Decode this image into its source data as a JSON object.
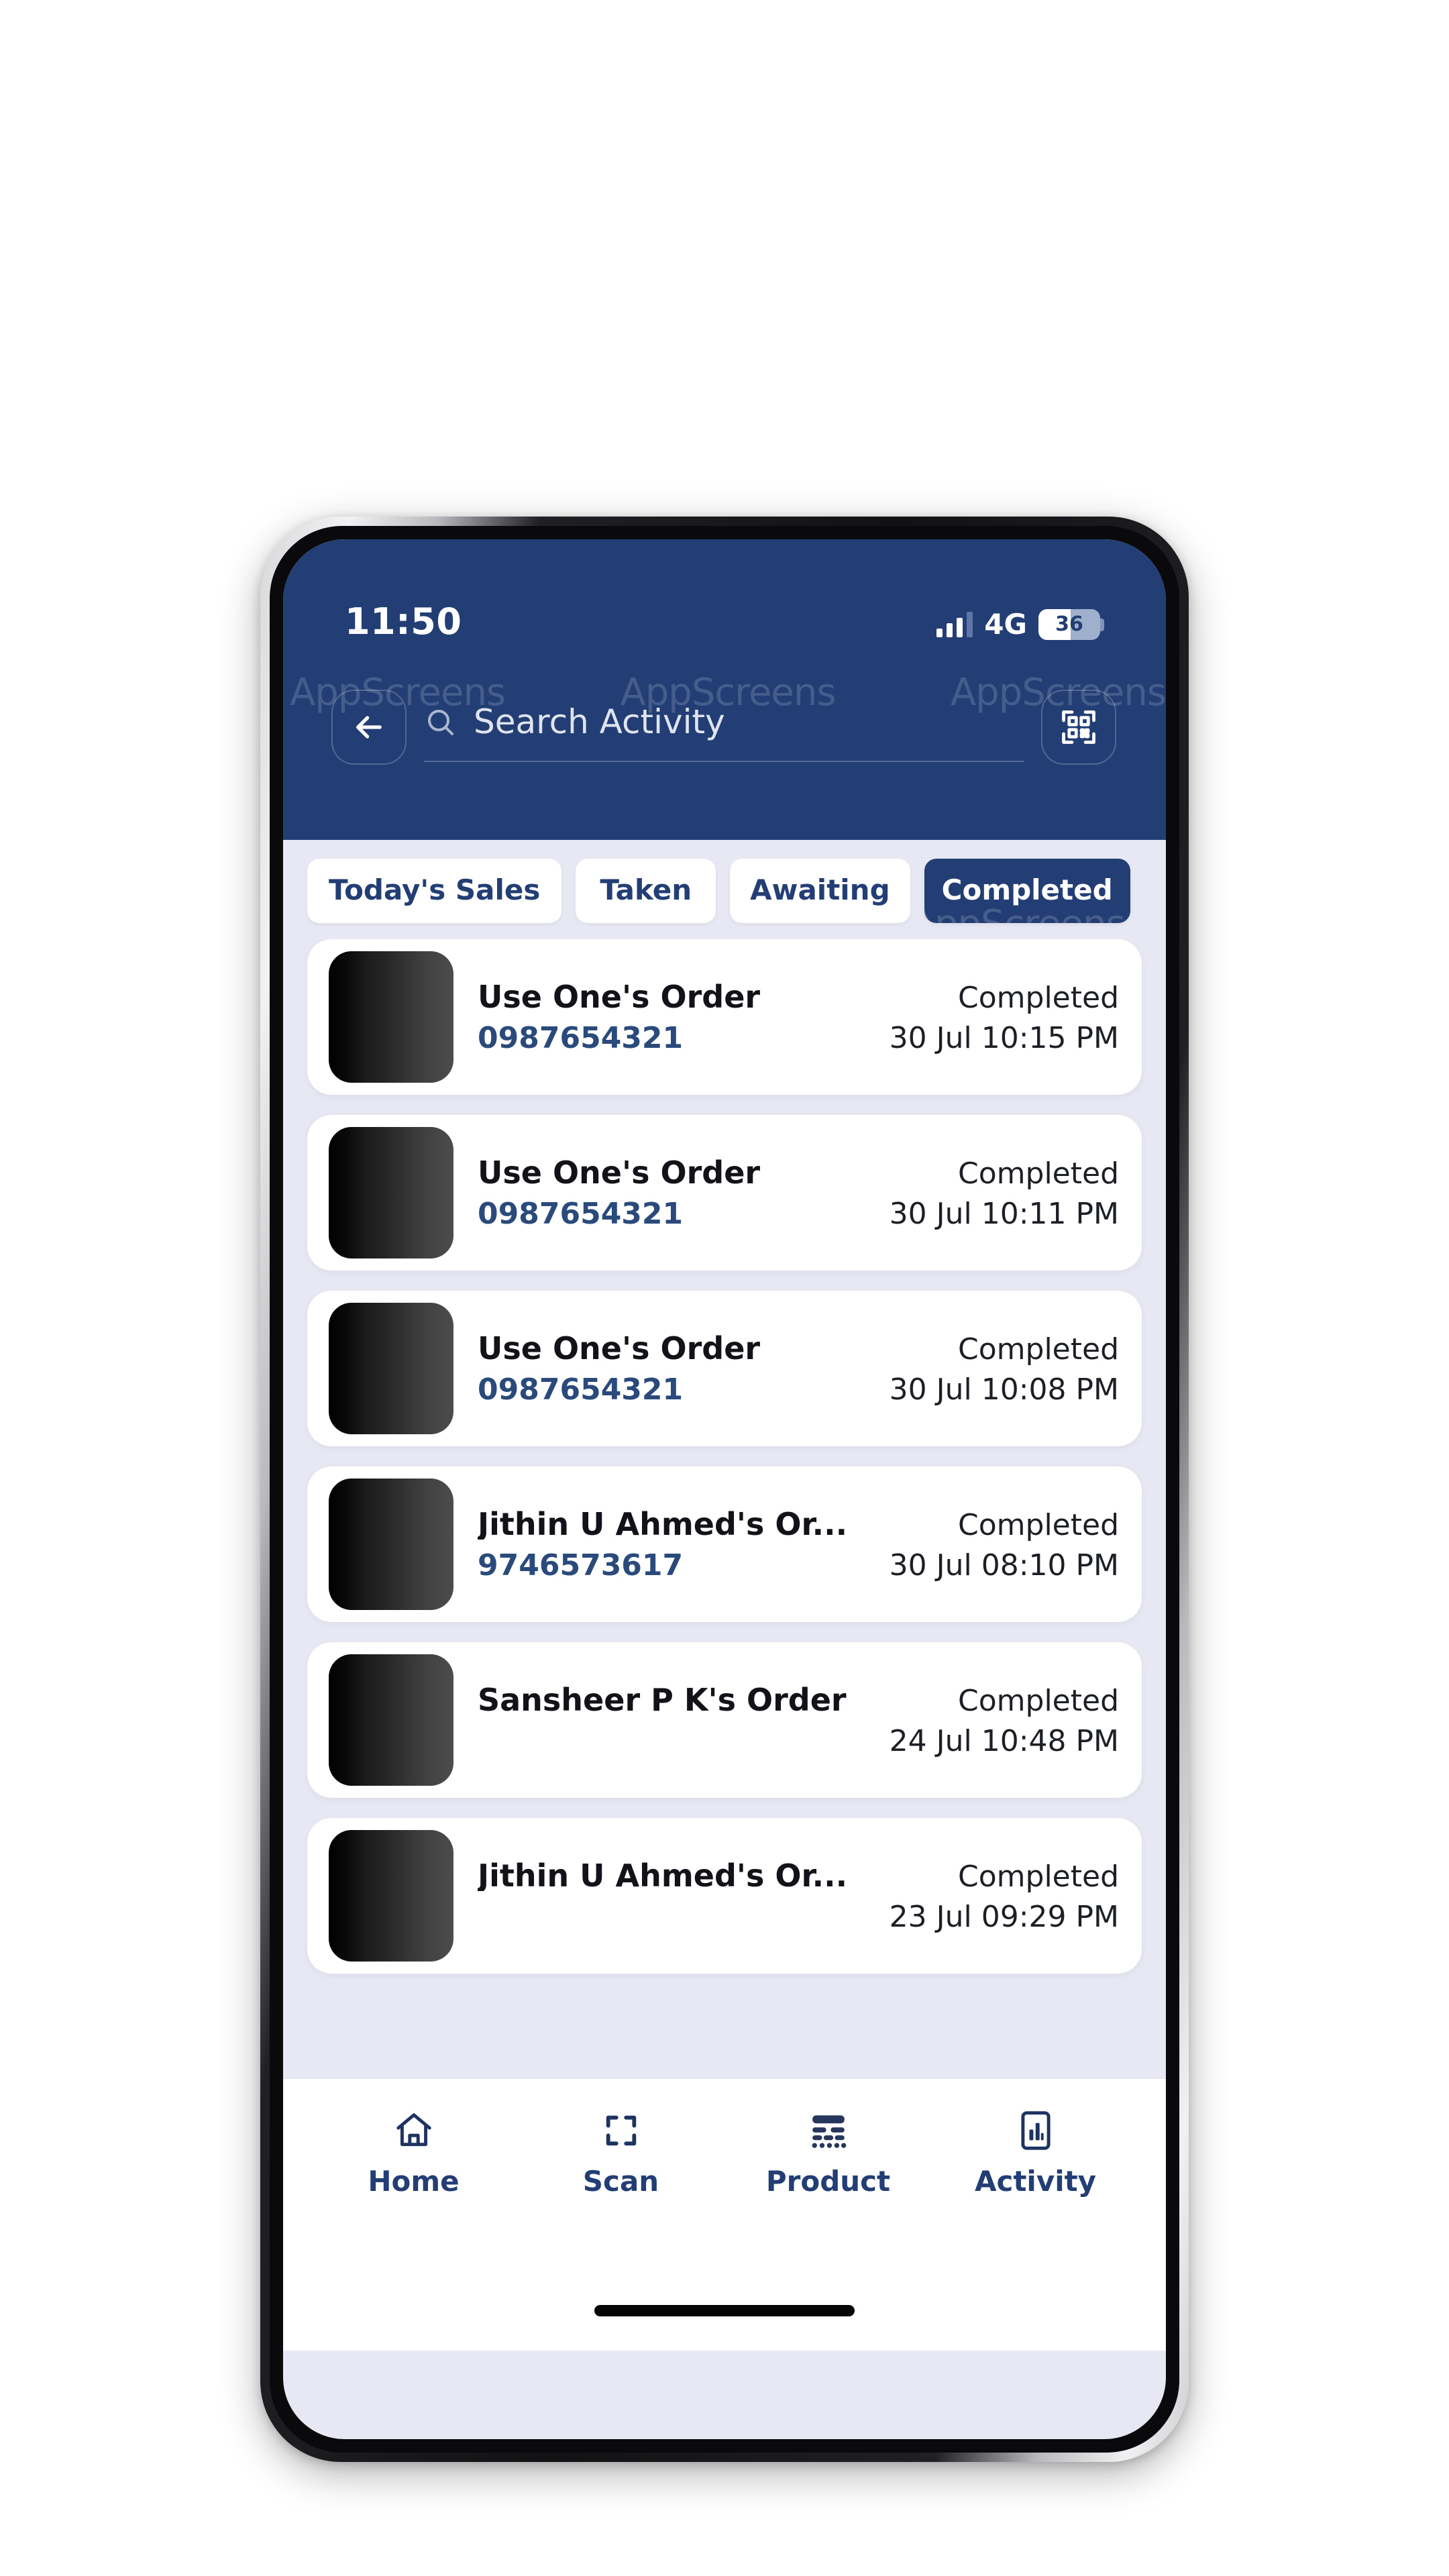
{
  "statusbar": {
    "time": "11:50",
    "network": "4G",
    "battery_percent": "36",
    "signal_icon": "signal-bars-icon",
    "battery_icon": "battery-icon"
  },
  "watermark": {
    "text": "AppScreens"
  },
  "header": {
    "back_icon": "back-arrow-icon",
    "search_icon": "search-icon",
    "qr_icon": "qr-scan-icon",
    "search_value": "",
    "search_placeholder": "Search Activity"
  },
  "tabs": [
    {
      "label": "Today's Sales",
      "active": false
    },
    {
      "label": "Taken",
      "active": false
    },
    {
      "label": "Awaiting",
      "active": false
    },
    {
      "label": "Completed",
      "active": true
    }
  ],
  "orders": [
    {
      "title": "Use One's Order",
      "phone": "0987654321",
      "status": "Completed",
      "datetime": "30 Jul 10:15 PM"
    },
    {
      "title": "Use One's Order",
      "phone": "0987654321",
      "status": "Completed",
      "datetime": "30 Jul 10:11 PM"
    },
    {
      "title": "Use One's Order",
      "phone": "0987654321",
      "status": "Completed",
      "datetime": "30 Jul 10:08 PM"
    },
    {
      "title": "Jithin U Ahmed's Or...",
      "phone": "9746573617",
      "status": "Completed",
      "datetime": "30 Jul 08:10 PM"
    },
    {
      "title": "Sansheer P K's Order",
      "phone": "",
      "status": "Completed",
      "datetime": "24 Jul 10:48 PM"
    },
    {
      "title": "Jithin U Ahmed's Or...",
      "phone": "",
      "status": "Completed",
      "datetime": "23 Jul 09:29 PM"
    }
  ],
  "bottomnav": [
    {
      "label": "Home",
      "icon": "home-icon"
    },
    {
      "label": "Scan",
      "icon": "scan-icon"
    },
    {
      "label": "Product",
      "icon": "product-icon"
    },
    {
      "label": "Activity",
      "icon": "activity-icon"
    }
  ],
  "colors": {
    "brand_navy": "#223E74",
    "page_background": "#E7E8F3",
    "card_background": "#FFFFFF",
    "phone_link": "#2A4A7B",
    "text_dark": "#111318"
  }
}
